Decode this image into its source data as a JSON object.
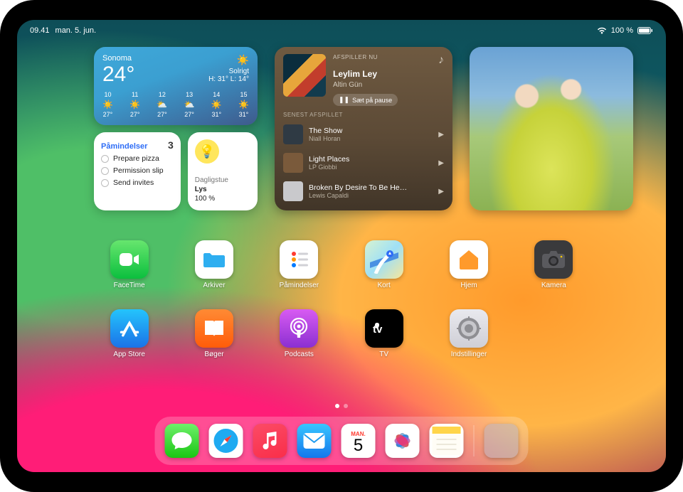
{
  "status": {
    "time": "09.41",
    "date": "man. 5. jun.",
    "battery_pct": "100 %"
  },
  "weather": {
    "location": "Sonoma",
    "temp": "24°",
    "condition": "Solrigt",
    "hi_lo": "H: 31° L: 14°",
    "hours": [
      {
        "h": "10",
        "icon": "☀️",
        "t": "27°"
      },
      {
        "h": "11",
        "icon": "☀️",
        "t": "27°"
      },
      {
        "h": "12",
        "icon": "⛅",
        "t": "27°"
      },
      {
        "h": "13",
        "icon": "⛅",
        "t": "27°"
      },
      {
        "h": "14",
        "icon": "☀️",
        "t": "31°"
      },
      {
        "h": "15",
        "icon": "☀️",
        "t": "31°"
      }
    ]
  },
  "reminders": {
    "title": "Påmindelser",
    "count": "3",
    "items": [
      "Prepare pizza",
      "Permission slip",
      "Send invites"
    ]
  },
  "home": {
    "room": "Dagligstue",
    "name": "Lys",
    "pct": "100 %"
  },
  "music": {
    "now_label": "AFSPILLER NU",
    "title": "Leylim Ley",
    "artist": "Altin Gün",
    "pause_label": "Sæt på pause",
    "recent_label": "SENEST AFSPILLET",
    "tracks": [
      {
        "title": "The Show",
        "artist": "Niall Horan",
        "color": "#2f3a44"
      },
      {
        "title": "Light Places",
        "artist": "LP Giobbi",
        "color": "#7a5a3b"
      },
      {
        "title": "Broken By Desire To Be He…",
        "artist": "Lewis Capaldi",
        "color": "#c9c9cc"
      }
    ]
  },
  "apps": {
    "row1": [
      {
        "id": "facetime",
        "label": "FaceTime"
      },
      {
        "id": "files",
        "label": "Arkiver"
      },
      {
        "id": "reminders",
        "label": "Påmindelser"
      },
      {
        "id": "maps",
        "label": "Kort"
      },
      {
        "id": "home",
        "label": "Hjem"
      },
      {
        "id": "camera",
        "label": "Kamera"
      }
    ],
    "row2": [
      {
        "id": "appstore",
        "label": "App Store"
      },
      {
        "id": "books",
        "label": "Bøger"
      },
      {
        "id": "podcasts",
        "label": "Podcasts"
      },
      {
        "id": "tv",
        "label": "TV"
      },
      {
        "id": "settings",
        "label": "Indstillinger"
      }
    ]
  },
  "calendar": {
    "weekday": "MAN.",
    "day": "5"
  }
}
